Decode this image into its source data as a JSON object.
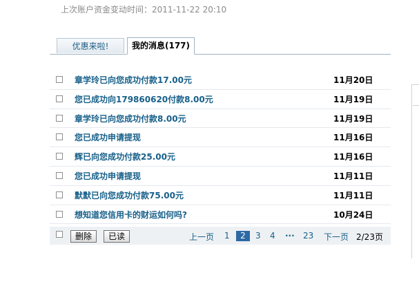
{
  "account": {
    "last_change_label": "上次账户资金变动时间：",
    "last_change_time": "2011-11-22 20:10"
  },
  "tabs": [
    {
      "label": "优惠来啦!",
      "active": false
    },
    {
      "label": "我的消息(177)",
      "active": true
    }
  ],
  "messages": [
    {
      "title": "章学玲已向您成功付款17.00元",
      "date": "11月20日"
    },
    {
      "title": "您已成功向179860620付款8.00元",
      "date": "11月19日"
    },
    {
      "title": "章学玲已向您成功付款8.00元",
      "date": "11月19日"
    },
    {
      "title": "您已成功申请提现",
      "date": "11月16日"
    },
    {
      "title": "辉已向您成功付款25.00元",
      "date": "11月16日"
    },
    {
      "title": "您已成功申请提现",
      "date": "11月11日"
    },
    {
      "title": "默默已向您成功付款75.00元",
      "date": "11月11日"
    },
    {
      "title": "想知道您信用卡的财运如何吗?",
      "date": "10月24日"
    }
  ],
  "actions": {
    "delete_label": "删除",
    "mark_read_label": "已读"
  },
  "pagination": {
    "prev_label": "上一页",
    "pages": [
      "1",
      "2",
      "3",
      "4"
    ],
    "current_page": "2",
    "ellipsis": "···",
    "last_page": "23",
    "next_label": "下一页",
    "page_count": "2/23页"
  },
  "colors": {
    "link": "#17608a",
    "current_page_bg": "#2d6aa4",
    "footer_bg": "#eef1f4"
  }
}
